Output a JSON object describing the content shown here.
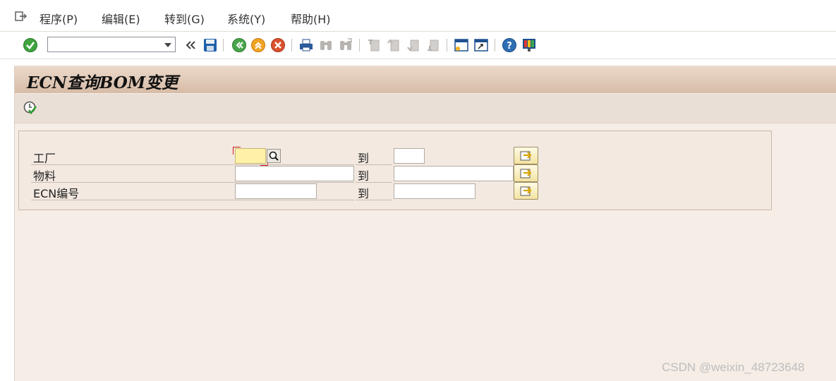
{
  "menu": {
    "exit_icon": "menu-exit-icon",
    "items": [
      {
        "label": "程序(P)"
      },
      {
        "label": "编辑(E)"
      },
      {
        "label": "转到(G)"
      },
      {
        "label": "系统(Y)"
      },
      {
        "label": "帮助(H)"
      }
    ]
  },
  "toolbar": {
    "command_field": {
      "value": "",
      "placeholder": ""
    },
    "icons": [
      "enter-icon",
      "command-dropdown-icon",
      "collapse-icon",
      "save-icon",
      "back-icon",
      "exit-icon",
      "cancel-icon",
      "print-icon",
      "find-icon",
      "find-next-icon",
      "first-page-icon",
      "previous-page-icon",
      "next-page-icon",
      "last-page-icon",
      "create-session-icon",
      "shortcut-icon",
      "help-icon",
      "customize-layout-icon"
    ]
  },
  "screen": {
    "title": "ECN查询BOM变更",
    "execute_icon": "execute-icon"
  },
  "selection": {
    "to_label": "到",
    "rows": [
      {
        "label": "工厂",
        "low": "",
        "high": "",
        "required": true
      },
      {
        "label": "物料",
        "low": "",
        "high": ""
      },
      {
        "label": "ECN编号",
        "low": "",
        "high": ""
      }
    ]
  },
  "colors": {
    "title_gradient_top": "#ecd9cb",
    "title_gradient_bottom": "#d7bca7",
    "background": "#f5ede6",
    "required_field": "#fff2a8",
    "focus_marker": "#d21a1a"
  },
  "watermark": "CSDN @weixin_48723648"
}
